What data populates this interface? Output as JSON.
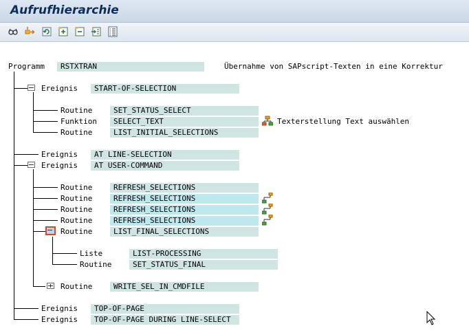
{
  "window": {
    "title": "Aufrufhierarchie"
  },
  "toolbar": {
    "buttons": [
      {
        "icon": "glasses-icon"
      },
      {
        "icon": "move-icon"
      },
      {
        "icon": "refresh-icon"
      },
      {
        "icon": "expand-icon"
      },
      {
        "icon": "collapse-icon"
      },
      {
        "icon": "select-icon"
      },
      {
        "icon": "list-icon"
      }
    ]
  },
  "tree": {
    "program": {
      "label": "Programm",
      "value": "RSTXTRAN",
      "description": "Übernahme von SAPscript-Texten in eine Korrektur"
    },
    "event1": {
      "label": "Ereignis",
      "value": "START-OF-SELECTION"
    },
    "e1_routine1": {
      "label": "Routine",
      "value": "SET_STATUS_SELECT"
    },
    "e1_function": {
      "label": "Funktion",
      "value": "SELECT_TEXT",
      "description": "Texterstellung Text auswählen"
    },
    "e1_routine2": {
      "label": "Routine",
      "value": "LIST_INITIAL_SELECTIONS"
    },
    "event2": {
      "label": "Ereignis",
      "value": "AT LINE-SELECTION"
    },
    "event3": {
      "label": "Ereignis",
      "value": "AT USER-COMMAND"
    },
    "e3_r1": {
      "label": "Routine",
      "value": "REFRESH_SELECTIONS"
    },
    "e3_r2": {
      "label": "Routine",
      "value": "REFRESH_SELECTIONS"
    },
    "e3_r3": {
      "label": "Routine",
      "value": "REFRESH_SELECTIONS"
    },
    "e3_r4": {
      "label": "Routine",
      "value": "REFRESH_SELECTIONS"
    },
    "e3_r5": {
      "label": "Routine",
      "value": "LIST_FINAL_SELECTIONS"
    },
    "r5_list": {
      "label": "Liste",
      "value": "LIST-PROCESSING"
    },
    "r5_routine": {
      "label": "Routine",
      "value": "SET_STATUS_FINAL"
    },
    "e3_r6": {
      "label": "Routine",
      "value": "WRITE_SEL_IN_CMDFILE"
    },
    "event4": {
      "label": "Ereignis",
      "value": "TOP-OF-PAGE"
    },
    "event5": {
      "label": "Ereignis",
      "value": "TOP-OF-PAGE DURING LINE-SELECT"
    }
  }
}
